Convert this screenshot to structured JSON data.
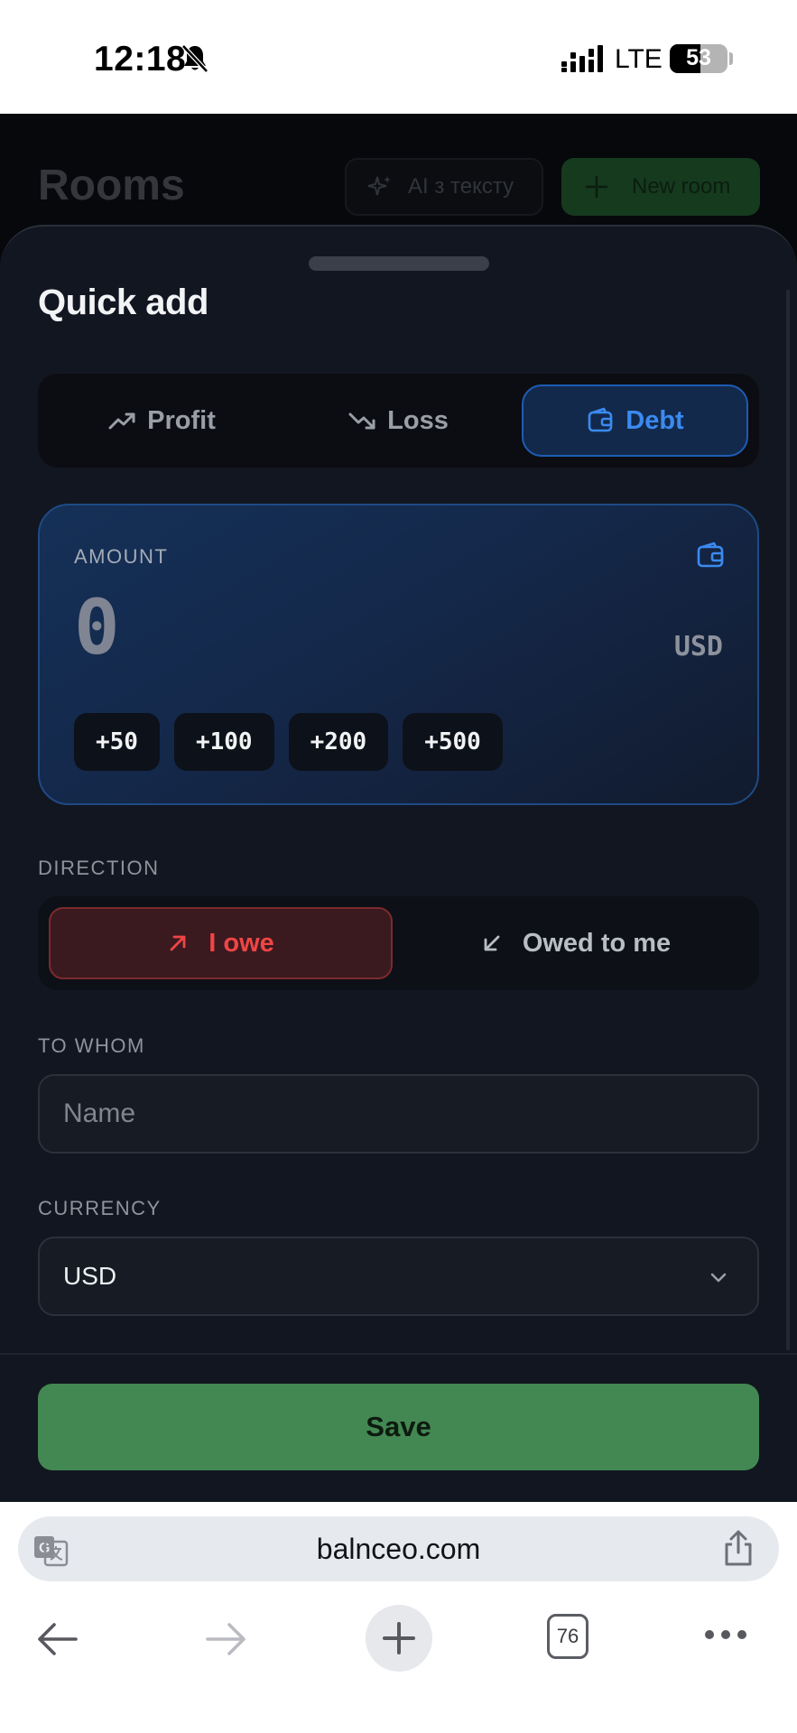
{
  "status_bar": {
    "time": "12:18",
    "network": "LTE",
    "battery": "53",
    "battery_level": 0.53
  },
  "background": {
    "title": "Rooms",
    "ai_button": "AI з тексту",
    "new_room_button": "New room"
  },
  "sheet": {
    "title": "Quick add",
    "type_tabs": [
      {
        "label": "Profit",
        "icon": "trending-up-icon",
        "active": false
      },
      {
        "label": "Loss",
        "icon": "trending-down-icon",
        "active": false
      },
      {
        "label": "Debt",
        "icon": "wallet-icon",
        "active": true
      }
    ],
    "amount": {
      "label": "AMOUNT",
      "value": "0",
      "currency": "USD",
      "quick_chips": [
        "+50",
        "+100",
        "+200",
        "+500"
      ]
    },
    "direction": {
      "label": "DIRECTION",
      "options": [
        {
          "label": "I owe",
          "icon": "arrow-up-right-icon",
          "active": true
        },
        {
          "label": "Owed to me",
          "icon": "arrow-down-left-icon",
          "active": false
        }
      ]
    },
    "to_whom": {
      "label": "TO WHOM",
      "placeholder": "Name",
      "value": ""
    },
    "currency": {
      "label": "CURRENCY",
      "selected": "USD"
    },
    "save_label": "Save"
  },
  "browser": {
    "url": "balnceo.com",
    "tab_count": "76"
  },
  "colors": {
    "sheet_bg": "#121620",
    "accent_blue": "#3b8af0",
    "danger_red": "#f04545",
    "save_green": "#438852"
  }
}
